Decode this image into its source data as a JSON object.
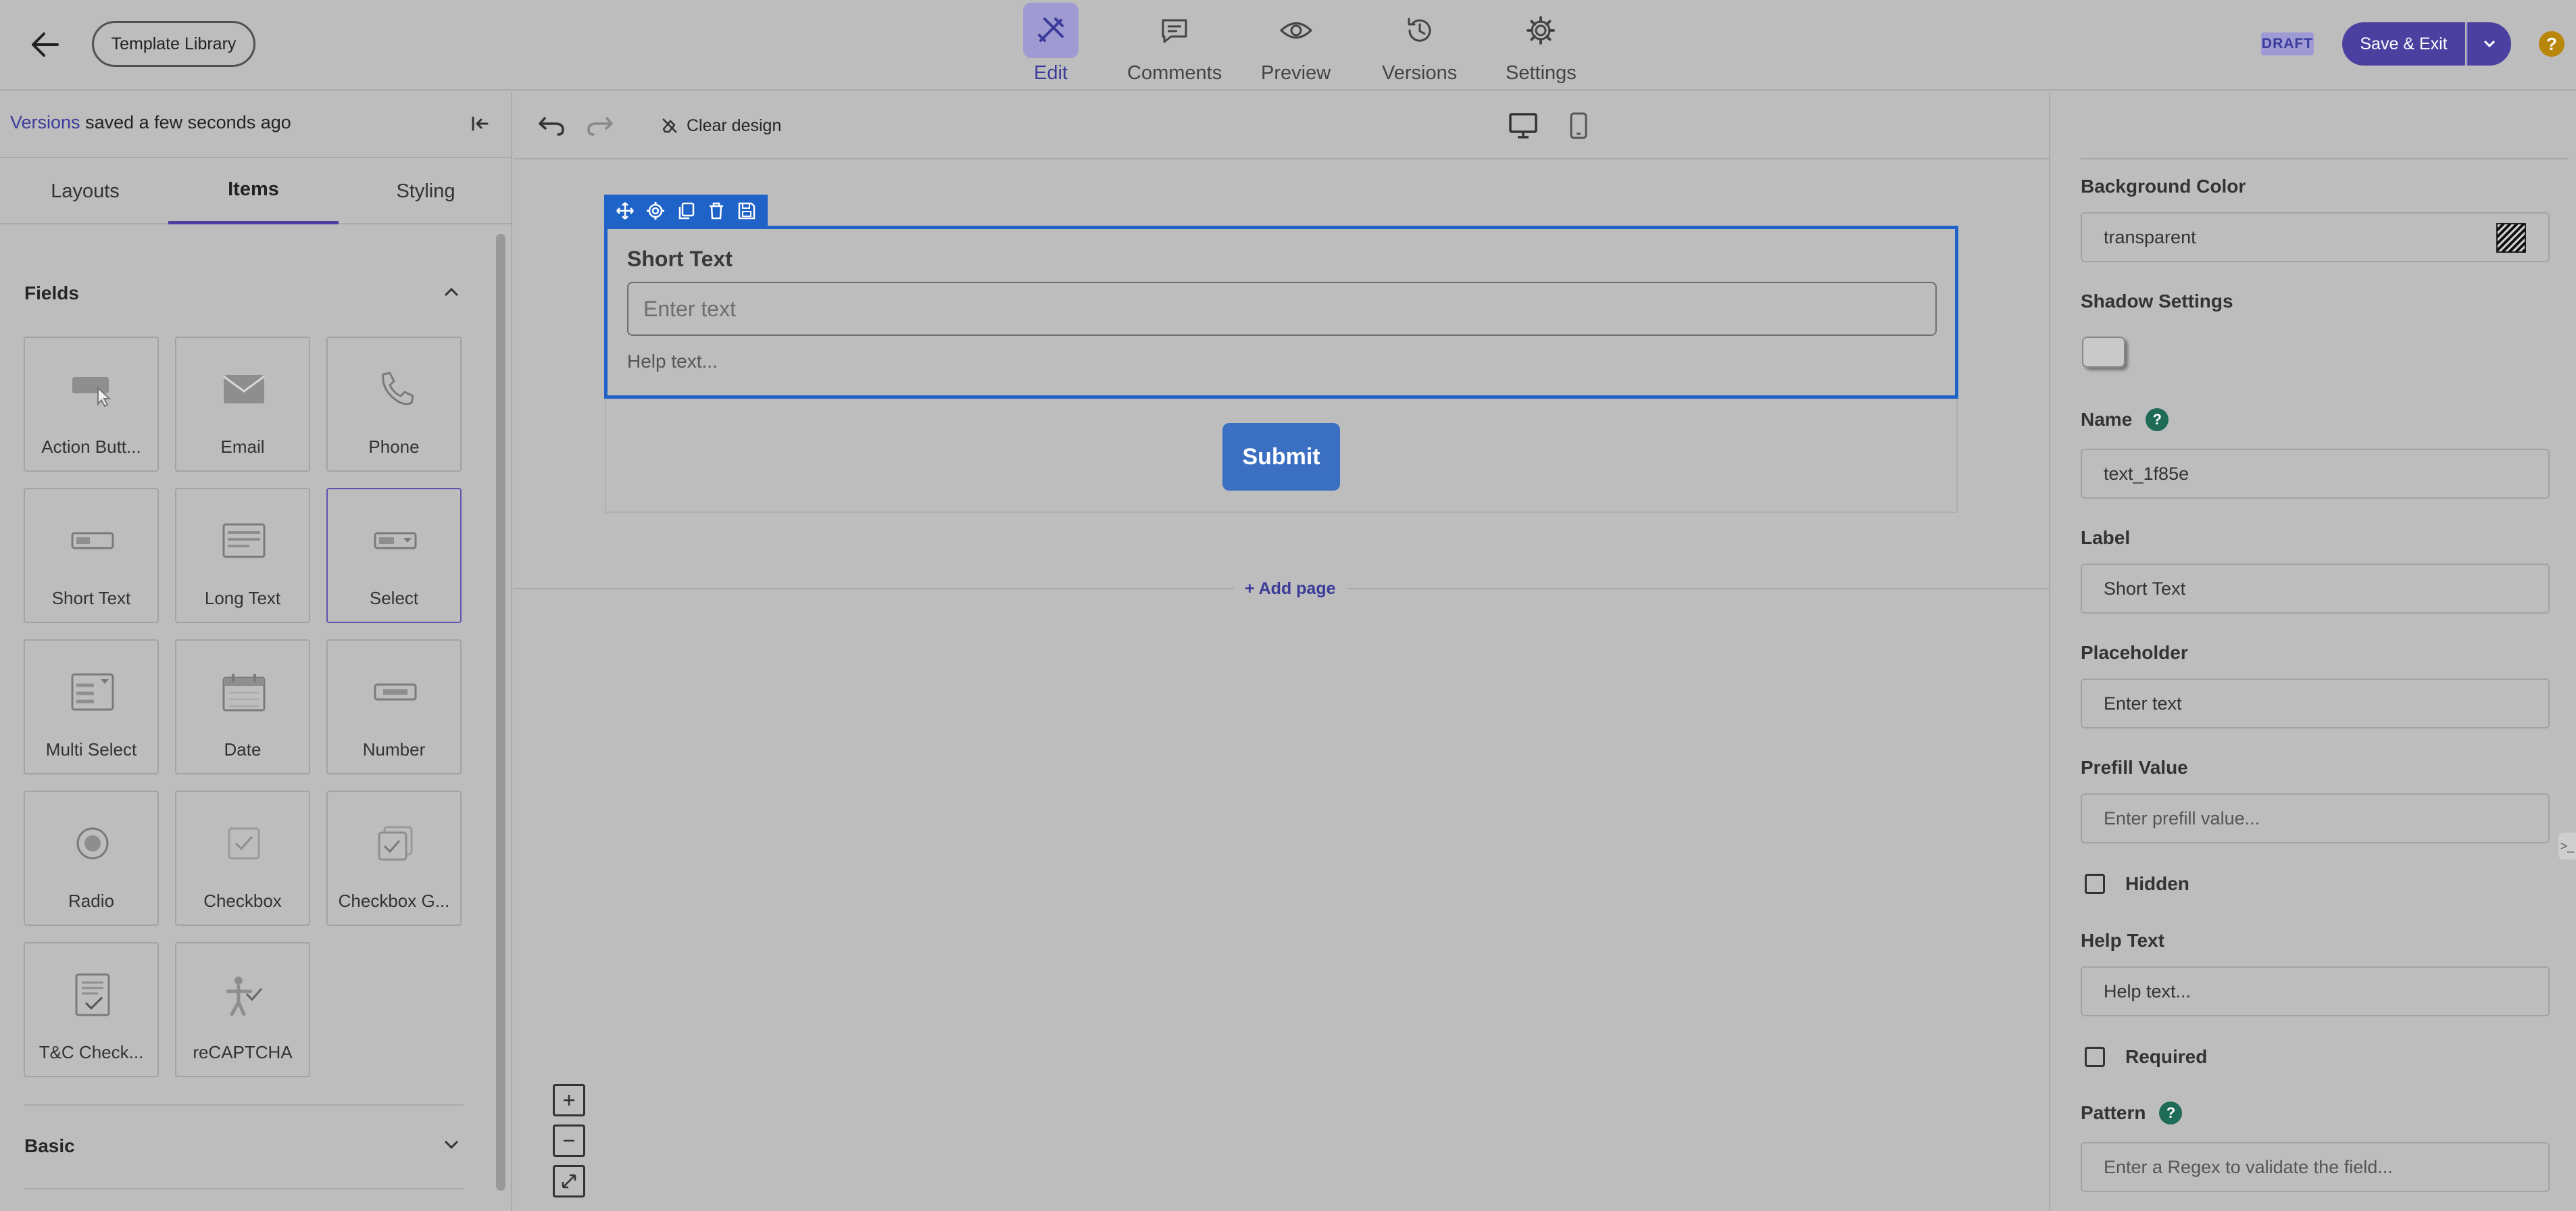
{
  "header": {
    "template_library": "Template Library",
    "tabs": [
      {
        "label": "Edit",
        "icon": "edit-tools-icon",
        "active": true
      },
      {
        "label": "Comments",
        "icon": "comment-icon"
      },
      {
        "label": "Preview",
        "icon": "eye-icon"
      },
      {
        "label": "Versions",
        "icon": "history-icon"
      },
      {
        "label": "Settings",
        "icon": "gear-icon"
      }
    ],
    "draft_badge": "DRAFT",
    "save_exit": "Save & Exit",
    "help": "?"
  },
  "left": {
    "saved_link": "Versions",
    "saved_text": " saved a few seconds ago",
    "tabs": [
      "Layouts",
      "Items",
      "Styling"
    ],
    "active_tab": "Items",
    "fields_heading": "Fields",
    "fields": [
      {
        "label": "Action Butt...",
        "icon": "action-button-icon"
      },
      {
        "label": "Email",
        "icon": "email-icon"
      },
      {
        "label": "Phone",
        "icon": "phone-icon"
      },
      {
        "label": "Short Text",
        "icon": "short-text-icon"
      },
      {
        "label": "Long Text",
        "icon": "long-text-icon"
      },
      {
        "label": "Select",
        "icon": "select-icon",
        "selected": true
      },
      {
        "label": "Multi Select",
        "icon": "multi-select-icon"
      },
      {
        "label": "Date",
        "icon": "calendar-icon"
      },
      {
        "label": "Number",
        "icon": "number-icon"
      },
      {
        "label": "Radio",
        "icon": "radio-icon"
      },
      {
        "label": "Checkbox",
        "icon": "checkbox-icon"
      },
      {
        "label": "Checkbox G...",
        "icon": "checkbox-group-icon"
      },
      {
        "label": "T&C Check...",
        "icon": "terms-checkbox-icon"
      },
      {
        "label": "reCAPTCHA",
        "icon": "recaptcha-icon"
      }
    ],
    "basic_heading": "Basic"
  },
  "canvas": {
    "clear_design": "Clear design",
    "field": {
      "label": "Short Text",
      "placeholder": "Enter text",
      "help": "Help text..."
    },
    "submit": "Submit",
    "add_page": "+ Add page",
    "zoom": [
      "+",
      "−",
      "⤢"
    ]
  },
  "right": {
    "background_color_label": "Background Color",
    "background_color_value": "transparent",
    "shadow_label": "Shadow Settings",
    "name_label": "Name",
    "name_value": "text_1f85e",
    "label_label": "Label",
    "label_value": "Short Text",
    "placeholder_label": "Placeholder",
    "placeholder_value": "Enter text",
    "prefill_label": "Prefill Value",
    "prefill_placeholder": "Enter prefill value...",
    "hidden_label": "Hidden",
    "help_text_label": "Help Text",
    "help_text_value": "Help text...",
    "required_label": "Required",
    "pattern_label": "Pattern",
    "pattern_placeholder": "Enter a Regex to validate the field...",
    "edge_handle": ">_"
  },
  "colors": {
    "accent": "#4b3fa0",
    "selection": "#1f63c8",
    "submit": "#3b6fc2",
    "help_badge": "#1e6b57"
  }
}
